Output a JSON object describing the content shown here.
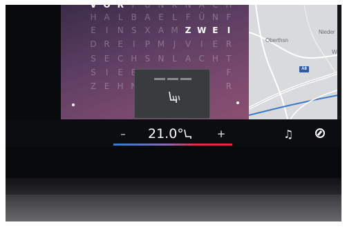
{
  "clock": {
    "rows": [
      {
        "letters": [
          "V",
          "O",
          "R",
          "F",
          "U",
          "N",
          "K",
          "N",
          "A",
          "C",
          "H"
        ],
        "on": [
          0,
          1,
          2
        ]
      },
      {
        "letters": [
          "H",
          "A",
          "L",
          "B",
          "A",
          "E",
          "L",
          "F",
          "Ü",
          "N",
          "F"
        ],
        "on": []
      },
      {
        "letters": [
          "E",
          "I",
          "N",
          "S",
          "X",
          "A",
          "M",
          "Z",
          "W",
          "E",
          "I"
        ],
        "on": [
          7,
          8,
          9,
          10
        ]
      },
      {
        "letters": [
          "D",
          "R",
          "E",
          "I",
          "P",
          "M",
          "J",
          "V",
          "I",
          "E",
          "R"
        ],
        "on": []
      },
      {
        "letters": [
          "S",
          "E",
          "C",
          "H",
          "S",
          "N",
          "L",
          "A",
          "C",
          "H",
          "T"
        ],
        "on": []
      },
      {
        "letters": [
          "S",
          "I",
          "E",
          "B",
          "",
          "",
          "",
          "",
          "",
          "",
          "F"
        ],
        "on": []
      },
      {
        "letters": [
          "Z",
          "E",
          "H",
          "N",
          "",
          "",
          "",
          "",
          "",
          "",
          "R"
        ],
        "on": []
      }
    ]
  },
  "map": {
    "labels": [
      {
        "text": "Oberthsn"
      },
      {
        "text": "Nieder"
      },
      {
        "text": "We"
      }
    ],
    "road": "A8"
  },
  "seat_popup": {
    "icon": "seat-heating-icon"
  },
  "climate": {
    "minus_label": "–",
    "plus_label": "+",
    "temperature": "21.0°",
    "seat_icon": "seat-icon"
  },
  "right_icons": {
    "music": "♫",
    "nav": "navigation-icon"
  },
  "colors": {
    "bar_cold": "#2f7dd8",
    "bar_hot": "#e0283c",
    "clock_panel": "#5c3e62"
  }
}
